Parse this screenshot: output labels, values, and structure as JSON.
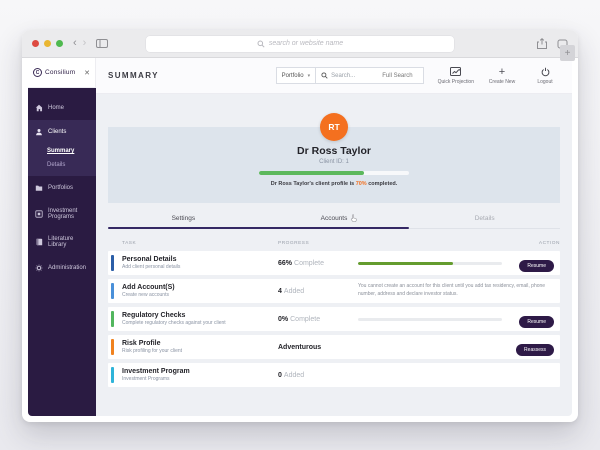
{
  "browser": {
    "url_placeholder": "search or website name",
    "back_glyph": "‹",
    "forward_glyph": "›",
    "new_tab_glyph": "+"
  },
  "sidebar": {
    "logo_text": "Consilium",
    "logo_mark": "C",
    "close_glyph": "✕",
    "items": [
      {
        "label": "Home"
      },
      {
        "label": "Clients",
        "children": [
          {
            "label": "Summary"
          },
          {
            "label": "Details"
          }
        ]
      },
      {
        "label": "Portfolios"
      },
      {
        "label": "Investment Programs"
      },
      {
        "label": "Literature Library"
      },
      {
        "label": "Administration"
      }
    ]
  },
  "header": {
    "title": "SUMMARY",
    "scope_selected": "Portfolio",
    "scope_chevron": "▾",
    "search_placeholder": "Search...",
    "full_search_label": "Full Search",
    "actions": [
      {
        "label": "Quick Projection",
        "icon": "projection-chart-icon"
      },
      {
        "label": "Create New",
        "icon": "plus-icon",
        "glyph": "+"
      },
      {
        "label": "Logout",
        "icon": "power-icon"
      }
    ]
  },
  "client": {
    "initials": "RT",
    "name": "Dr Ross Taylor",
    "id_label": "Client ID: 1",
    "profile_percent": 70,
    "caption_prefix": "Dr Ross Taylor's client profile is ",
    "caption_percent": "70%",
    "caption_suffix": " completed."
  },
  "tabs": [
    {
      "label": "Settings"
    },
    {
      "label": "Accounts"
    },
    {
      "label": "Details"
    }
  ],
  "table": {
    "headers": [
      "TASK",
      "PROGRESS",
      "ACTION"
    ],
    "rows": [
      {
        "title": "Personal Details",
        "subtitle": "Add client personal details",
        "value": "66%",
        "value_suffix": "Complete",
        "percent": 66,
        "action": "Resume",
        "accent": "#2b5ea7"
      },
      {
        "title": "Add Account(S)",
        "subtitle": "Create new accounts",
        "value": "4",
        "value_suffix": "Added",
        "note": "You cannot create an account for this client until you add tax residency, email, phone number, address and declare investor status.",
        "accent": "#4a90d9"
      },
      {
        "title": "Regulatory Checks",
        "subtitle": "Complete regulatory checks against your client",
        "value": "0%",
        "value_suffix": "Complete",
        "percent": 0,
        "action": "Resume",
        "accent": "#52b65e"
      },
      {
        "title": "Risk Profile",
        "subtitle": "Risk profiling for your client",
        "value": "Adventurous",
        "value_suffix": "",
        "action": "Reassess",
        "accent": "#f0821f"
      },
      {
        "title": "Investment Program",
        "subtitle": "Investment Programs",
        "value": "0",
        "value_suffix": "Added",
        "accent": "#2fb4d9"
      }
    ]
  },
  "colors": {
    "accent_orange": "#f4701f",
    "profile_bar_green": "#5cb85c",
    "task_bar_green": "#649c2e",
    "button_purple": "#2e1a47",
    "sidebar_purple": "#2a1b42",
    "sidebar_active_purple": "#382a56",
    "tab_underline_purple": "#342864",
    "banner_blue_gray": "#dde4ec"
  }
}
